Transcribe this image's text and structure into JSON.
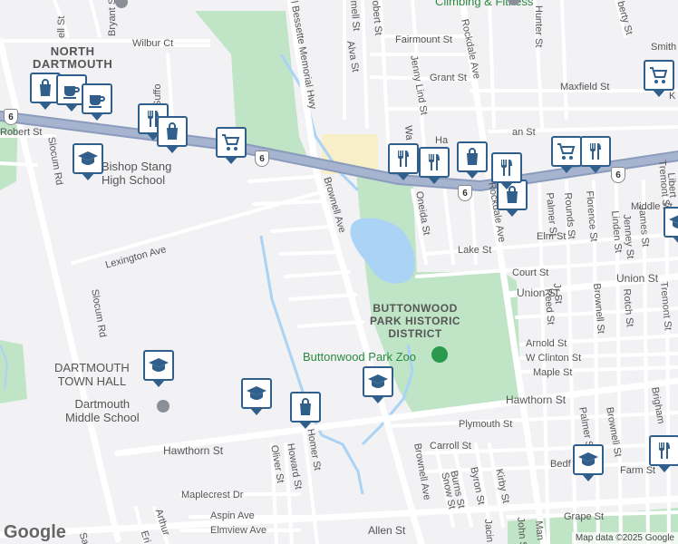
{
  "map": {
    "attribution": "Map data ©2025 Google",
    "logo": "Google",
    "colors": {
      "background": "#f2f1f4",
      "park": "#bfe5c6",
      "water": "#aad3f5",
      "highway": "#9aa9c8",
      "road": "#ffffff",
      "pin_border": "#2f5f8a",
      "commercial": "#f8efc8"
    }
  },
  "places": {
    "north_dartmouth": "NORTH\nDARTMOUTH",
    "buttonwood_district": "BUTTONWOOD\nPARK HISTORIC\nDISTRICT",
    "dartmouth_town_hall": "DARTMOUTH\nTOWN HALL",
    "dartmouth_middle_school": "Dartmouth\nMiddle School",
    "bishop_stang": "Bishop Stang\nHigh School",
    "buttonwood_zoo": "Buttonwood Park Zoo",
    "climbing_fitness": "Climbing & Fitness"
  },
  "route_shields": [
    "6",
    "6",
    "6"
  ],
  "streets": {
    "bryant": "Bryant St",
    "robert_nw": "Robert St",
    "wilbur": "Wilbur Ct",
    "suffolk": "Suffo",
    "slocum_rd_n": "Slocum Rd",
    "slocum_rd_s": "Slocum Rd",
    "lexington": "Lexington Ave",
    "bessette": "l Bessette Memorial Hwy",
    "brownell_ave_n": "Brownell Ave",
    "brownell_ave_s": "Brownell Ave",
    "alva": "Alva St",
    "jenny_lind": "Jenny Lind St",
    "fairmount": "Fairmount St",
    "grant": "Grant St",
    "rockdale_n": "Rockdale Ave",
    "rockdale_s": "Rockdale Ave",
    "maxfield": "Maxfield St",
    "hunter": "Hunter St",
    "smith": "Smith",
    "liberty_top": "berty St",
    "oneida": "Oneida St",
    "lake": "Lake St",
    "elm": "Elm St",
    "court": "Court St",
    "union": "Union St",
    "middle": "Middle St",
    "palmer_n": "Palmer St",
    "rounds": "Rounds St",
    "florence": "Florence St",
    "linden": "Linden St",
    "jenney": "Jenney St",
    "james": "James St",
    "tremont_n": "Tremont St",
    "tremont_s": "Tremont St",
    "liberty_e": "Libert",
    "reed": "Reed St",
    "jr": "Jr St",
    "brownell_st": "Brownell St",
    "rotch": "Rotch St",
    "arnold": "Arnold St",
    "w_clinton": "W Clinton St",
    "maple": "Maple St",
    "hawthorn_e": "Hawthorn St",
    "hawthorn_w": "Hawthorn St",
    "plymouth": "Plymouth St",
    "carroll": "Carroll St",
    "palmer_s": "Palmer St",
    "brownell_st_s": "Brownell St",
    "brigham": "Brigham",
    "bedford": "Bedf",
    "farm": "Farm St",
    "snow": "Snow St",
    "byron": "Byron St",
    "burns": "Burns St",
    "kirby": "Kirby St",
    "grape": "Grape St",
    "allen": "Allen St",
    "john_s": "John S",
    "jacin": "Jacin",
    "man": "Man",
    "maplecrest": "Maplecrest Dr",
    "aspin": "Aspin Ave",
    "elmview": "Elmview Ave",
    "oliver": "Oliver St",
    "howard": "Howard St",
    "homer": "Homer St",
    "arthur": "Arthur",
    "eri": "Eri",
    "sa": "Sa",
    "hell": "ell St",
    "obert_top": "obert St",
    "an_st": "an St",
    "wa": "Wa",
    "ha": "Ha",
    "k": "K"
  },
  "markers": [
    {
      "name": "shopping-marker",
      "icon": "shopping-bag-icon"
    },
    {
      "name": "cafe-marker",
      "icon": "coffee-cup-icon"
    },
    {
      "name": "cafe-marker",
      "icon": "coffee-cup-icon"
    },
    {
      "name": "restaurant-marker",
      "icon": "fork-knife-icon"
    },
    {
      "name": "shopping-marker",
      "icon": "shopping-bag-icon"
    },
    {
      "name": "grocery-marker",
      "icon": "shopping-cart-icon"
    },
    {
      "name": "school-marker",
      "icon": "graduation-cap-icon"
    },
    {
      "name": "school-marker",
      "icon": "graduation-cap-icon"
    },
    {
      "name": "school-marker",
      "icon": "graduation-cap-icon"
    },
    {
      "name": "shopping-marker",
      "icon": "shopping-bag-icon"
    },
    {
      "name": "school-marker",
      "icon": "graduation-cap-icon"
    },
    {
      "name": "grocery-marker",
      "icon": "shopping-cart-icon"
    },
    {
      "name": "restaurant-marker",
      "icon": "fork-knife-icon"
    },
    {
      "name": "restaurant-marker",
      "icon": "fork-knife-icon"
    },
    {
      "name": "shopping-marker",
      "icon": "shopping-bag-icon"
    },
    {
      "name": "restaurant-marker",
      "icon": "fork-knife-icon"
    },
    {
      "name": "shopping-marker",
      "icon": "shopping-bag-icon"
    },
    {
      "name": "grocery-marker",
      "icon": "shopping-cart-icon"
    },
    {
      "name": "restaurant-marker",
      "icon": "fork-knife-icon"
    },
    {
      "name": "school-marker",
      "icon": "graduation-cap-icon"
    },
    {
      "name": "school-marker",
      "icon": "graduation-cap-icon"
    },
    {
      "name": "restaurant-marker",
      "icon": "fork-knife-icon"
    }
  ]
}
